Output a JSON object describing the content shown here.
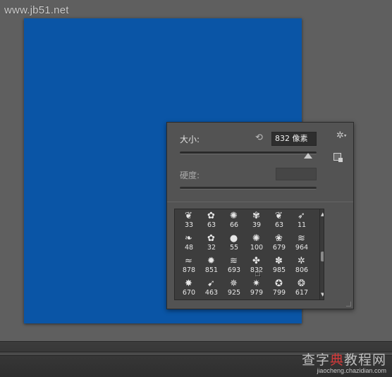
{
  "watermark_top": "www.jb51.net",
  "brush_panel": {
    "size_label": "大小:",
    "size_value": "832 像素",
    "size_slider_fraction": 0.94,
    "hardness_label": "硬度:",
    "hardness_value": "",
    "icons": {
      "reset": "reset-icon",
      "gear": "gear-icon",
      "new_preset": "new-preset-icon"
    },
    "brushes": [
      {
        "num": "33",
        "glyph": "❦"
      },
      {
        "num": "63",
        "glyph": "✿"
      },
      {
        "num": "66",
        "glyph": "✺"
      },
      {
        "num": "39",
        "glyph": "✾"
      },
      {
        "num": "63",
        "glyph": "❦"
      },
      {
        "num": "11",
        "glyph": "➶"
      },
      {
        "num": "48",
        "glyph": "❧"
      },
      {
        "num": "32",
        "glyph": "✿"
      },
      {
        "num": "55",
        "glyph": "●"
      },
      {
        "num": "100",
        "glyph": "✺"
      },
      {
        "num": "679",
        "glyph": "❀"
      },
      {
        "num": "964",
        "glyph": "≋"
      },
      {
        "num": "878",
        "glyph": "≈"
      },
      {
        "num": "851",
        "glyph": "✹"
      },
      {
        "num": "693",
        "glyph": "≋"
      },
      {
        "num": "832",
        "glyph": "✤"
      },
      {
        "num": "985",
        "glyph": "✽"
      },
      {
        "num": "806",
        "glyph": "✲"
      },
      {
        "num": "670",
        "glyph": "✸"
      },
      {
        "num": "463",
        "glyph": "➹"
      },
      {
        "num": "925",
        "glyph": "✵"
      },
      {
        "num": "979",
        "glyph": "✷"
      },
      {
        "num": "799",
        "glyph": "✪"
      },
      {
        "num": "617",
        "glyph": "❂"
      }
    ]
  },
  "watermark_bottom": {
    "text_gray": "查字",
    "text_red": "典",
    "text_gray2": "教程网",
    "url": "jiaocheng.chazidian.com"
  },
  "colors": {
    "canvas": "#0a55a6",
    "workspace": "#5f5f5f",
    "panel": "#535353"
  }
}
